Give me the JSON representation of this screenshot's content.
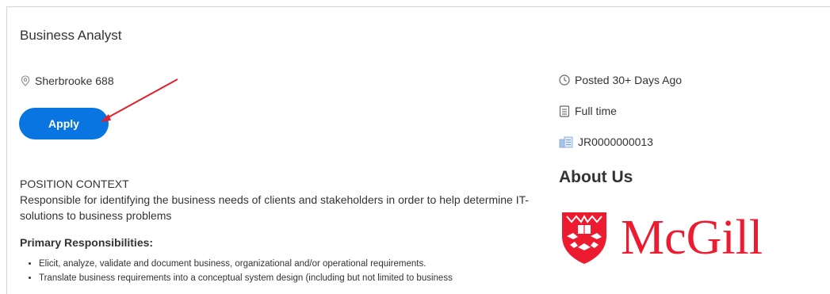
{
  "job": {
    "title": "Business Analyst",
    "location": "Sherbrooke 688",
    "apply_label": "Apply"
  },
  "meta": {
    "posted": "Posted 30+ Days Ago",
    "time_type": "Full time",
    "job_id": "JR0000000013"
  },
  "description": {
    "context_heading": "POSITION CONTEXT",
    "context_text": "Responsible for identifying the business needs of clients and stakeholders in order to help determine IT-solutions to business problems",
    "responsibilities_heading": "Primary Responsibilities:",
    "responsibilities": [
      "Elicit, analyze, validate and document business, organizational and/or operational requirements.",
      "Translate business requirements into a conceptual system design (including but not limited to business"
    ]
  },
  "about": {
    "heading": "About Us",
    "logo_text": "McGill"
  },
  "colors": {
    "apply_button": "#0875e1",
    "brand_red": "#ed1b2f",
    "annotation_arrow": "#e0202a"
  }
}
